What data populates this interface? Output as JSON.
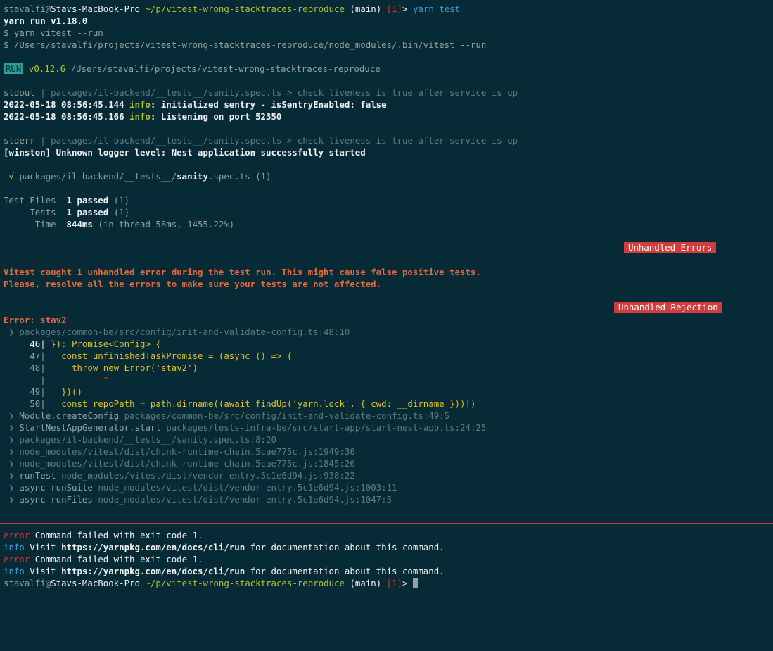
{
  "prompt": {
    "user": "stavalfi",
    "at": "@",
    "host": "Stavs-MacBook-Pro",
    "path": "~/p/vitest-wrong-stacktraces-reproduce",
    "branch": "(main)",
    "status": "[1]",
    "arrow": ">",
    "command": "yarn test"
  },
  "yarn_header": {
    "run_line": "yarn run v1.18.0",
    "cmd1": "$ yarn vitest --run",
    "cmd2": "$ /Users/stavalfi/projects/vitest-wrong-stacktraces-reproduce/node_modules/.bin/vitest --run"
  },
  "run_banner": {
    "badge": "RUN",
    "version": "v0.12.6",
    "path": "/Users/stavalfi/projects/vitest-wrong-stacktraces-reproduce"
  },
  "stdout": {
    "label": "stdout",
    "context": "| packages/il-backend/__tests__/sanity.spec.ts > check liveness is true after service is up",
    "logs": [
      {
        "ts": "2022-05-18 08:56:45.144",
        "level": "info",
        "msg": ": initialized sentry - isSentryEnabled: false"
      },
      {
        "ts": "2022-05-18 08:56:45.166",
        "level": "info",
        "msg": ": Listening on port 52350"
      }
    ]
  },
  "stderr": {
    "label": "stderr",
    "context": "| packages/il-backend/__tests__/sanity.spec.ts > check liveness is true after service is up",
    "msg": "[winston] Unknown logger level: Nest application successfully started"
  },
  "test_result": {
    "check": "√",
    "dir": "packages/il-backend/__tests__/",
    "file": "sanity",
    "ext": ".spec.ts",
    "count": "(1)"
  },
  "summary": {
    "files_label": "Test Files",
    "files_value": "1 passed",
    "files_count": "(1)",
    "tests_label": "Tests",
    "tests_value": "1 passed",
    "tests_count": "(1)",
    "time_label": "Time",
    "time_value": "844ms",
    "time_detail": "(in thread 58ms, 1455.22%)"
  },
  "unhandled": {
    "errors_tag": "Unhandled Errors",
    "line1": "Vitest caught 1 unhandled error during the test run. This might cause false positive tests.",
    "line2": "Please, resolve all the errors to make sure your tests are not affected.",
    "rejection_tag": "Unhandled Rejection",
    "error": "Error: stav2"
  },
  "stack_head": "❯ packages/common-be/src/config/init-and-validate-config.ts:48:10",
  "code": [
    {
      "num": "46|",
      "text": " }): Promise<Config> {"
    },
    {
      "num": "47|",
      "text": "   const unfinishedTaskPromise = (async () => {"
    },
    {
      "num": "48|",
      "text": "     throw new Error('stav2')"
    },
    {
      "num": "|",
      "text": "           ^"
    },
    {
      "num": "49|",
      "text": "   })()"
    },
    {
      "num": "50|",
      "text": "   const repoPath = path.dirname((await findUp('yarn.lock', { cwd: __dirname }))!)"
    }
  ],
  "stack": [
    {
      "fn": "Module.createConfig",
      "loc": "packages/common-be/src/config/init-and-validate-config.ts:49:5"
    },
    {
      "fn": "StartNestAppGenerator.start",
      "loc": "packages/tests-infra-be/src/start-app/start-nest-app.ts:24:25"
    },
    {
      "fn": "",
      "loc": "packages/il-backend/__tests__/sanity.spec.ts:8:20"
    },
    {
      "fn": "",
      "loc": "node_modules/vitest/dist/chunk-runtime-chain.5cae775c.js:1949:36"
    },
    {
      "fn": "",
      "loc": "node_modules/vitest/dist/chunk-runtime-chain.5cae775c.js:1845:26"
    },
    {
      "fn": "runTest",
      "loc": "node_modules/vitest/dist/vendor-entry.5c1e6d94.js:938:22"
    },
    {
      "fn": "async runSuite",
      "loc": "node_modules/vitest/dist/vendor-entry.5c1e6d94.js:1003:11"
    },
    {
      "fn": "async runFiles",
      "loc": "node_modules/vitest/dist/vendor-entry.5c1e6d94.js:1047:5"
    }
  ],
  "footer": [
    {
      "level": "error",
      "pre": " Command failed with exit code 1.",
      "url": "",
      "post": ""
    },
    {
      "level": "info",
      "pre": " Visit ",
      "url": "https://yarnpkg.com/en/docs/cli/run",
      "post": " for documentation about this command."
    },
    {
      "level": "error",
      "pre": " Command failed with exit code 1.",
      "url": "",
      "post": ""
    },
    {
      "level": "info",
      "pre": " Visit ",
      "url": "https://yarnpkg.com/en/docs/cli/run",
      "post": " for documentation about this command."
    }
  ],
  "stack_marker": "❯",
  "colors": {
    "background": "#072b36",
    "accent_red": "#dc322f",
    "badge_cyan": "#2aa198",
    "info_blue": "#3a9ee0",
    "warn_yellow": "#e0c21a",
    "error_orange": "#e8683a"
  }
}
